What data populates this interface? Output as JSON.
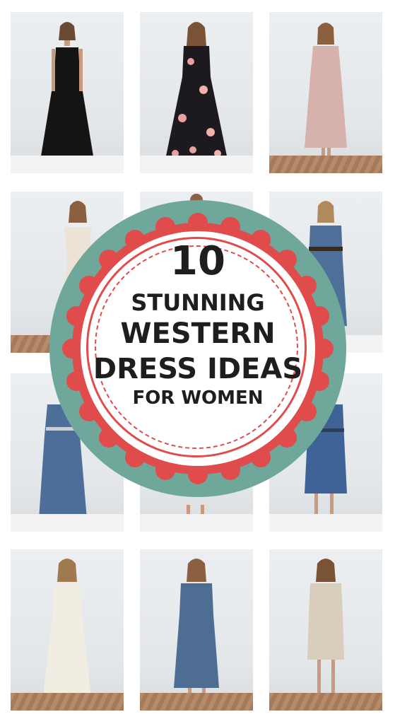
{
  "badge": {
    "number": "10",
    "line1": "STUNNING",
    "line2": "WESTERN",
    "line3": "DRESS IDEAS",
    "line4": "FOR WOMEN",
    "colors": {
      "outer": "#6fa79a",
      "scallop": "#e04b4b",
      "inner": "#ffffff",
      "text": "#1e1e1e"
    }
  },
  "photos": [
    {
      "id": "black-slip-maxi-dress",
      "dress_color": "#141414"
    },
    {
      "id": "floral-wrap-maxi-dress",
      "dress_color": "#1c1a1e"
    },
    {
      "id": "blush-wrap-midi-dress",
      "dress_color": "#d7b2ac"
    },
    {
      "id": "ivory-off-shoulder-gown",
      "dress_color": "#ece3d6"
    },
    {
      "id": "hidden-behind-badge",
      "dress_color": "#dddddd"
    },
    {
      "id": "denim-shirt-dress-belted",
      "dress_color": "#4d6f98"
    },
    {
      "id": "denim-button-maxi-dress",
      "dress_color": "#4e6e9a"
    },
    {
      "id": "hidden-behind-badge-2",
      "dress_color": "#dddddd"
    },
    {
      "id": "denim-shirt-midi-dress",
      "dress_color": "#3f6396"
    },
    {
      "id": "white-pleated-maxi-dress",
      "dress_color": "#f1ede3"
    },
    {
      "id": "blue-pleated-wrap-dress",
      "dress_color": "#4d6e92"
    },
    {
      "id": "sequin-wrap-dress",
      "dress_color": "#d9cdbb"
    }
  ]
}
